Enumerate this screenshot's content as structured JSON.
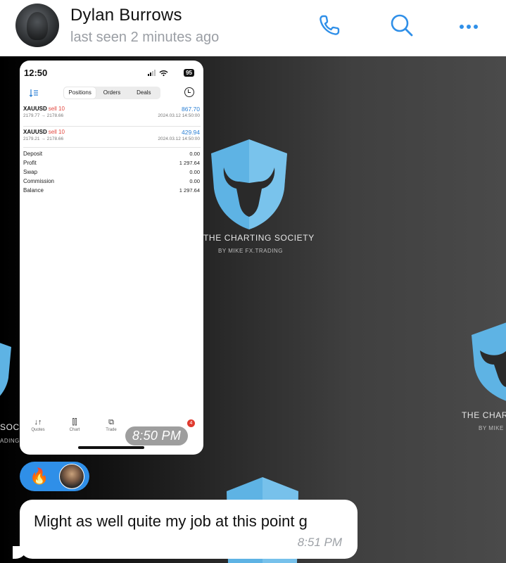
{
  "header": {
    "contact_name": "Dylan Burrows",
    "status": "last seen 2 minutes ago",
    "icons": [
      "phone-icon",
      "search-icon",
      "more-icon"
    ]
  },
  "watermark": {
    "brand": "THE CHARTING SOCIETY",
    "sub": "BY MIKE FX.TRADING",
    "partial_left": "SOCI",
    "partial_left_sub": "ADING",
    "partial_right": "THE CHART",
    "partial_right_sub": "BY MIKE"
  },
  "photo_message": {
    "phone_time": "12:50",
    "battery": "95",
    "tabs": [
      "Positions",
      "Orders",
      "Deals"
    ],
    "positions": [
      {
        "symbol": "XAUUSD",
        "side": "sell 10",
        "prices": "2179.77 → 2178.66",
        "profit": "867.70",
        "date": "2024.03.12 14:50:00"
      },
      {
        "symbol": "XAUUSD",
        "side": "sell 10",
        "prices": "2179.21 → 2178.66",
        "profit": "429.94",
        "date": "2024.03.12 14:50:00"
      }
    ],
    "summary": [
      {
        "label": "Deposit",
        "value": "0.00"
      },
      {
        "label": "Profit",
        "value": "1 297.64"
      },
      {
        "label": "Swap",
        "value": "0.00"
      },
      {
        "label": "Commission",
        "value": "0.00"
      },
      {
        "label": "Balance",
        "value": "1 297.64"
      }
    ],
    "bottom_tabs": [
      {
        "label": "Quotes",
        "icon": "quotes-icon"
      },
      {
        "label": "Chart",
        "icon": "candles-icon"
      },
      {
        "label": "Trade",
        "icon": "trade-chart-icon"
      }
    ],
    "notification_count": "4",
    "time": "8:50 PM"
  },
  "reaction": {
    "emoji": "🔥"
  },
  "text_message": {
    "text": "Might as well quite my job at this point g",
    "time": "8:51 PM"
  },
  "colors": {
    "accent": "#2f8fe8",
    "sell": "#e2463d",
    "profit": "#2a7fd4",
    "shield": "#5eb3e4"
  }
}
